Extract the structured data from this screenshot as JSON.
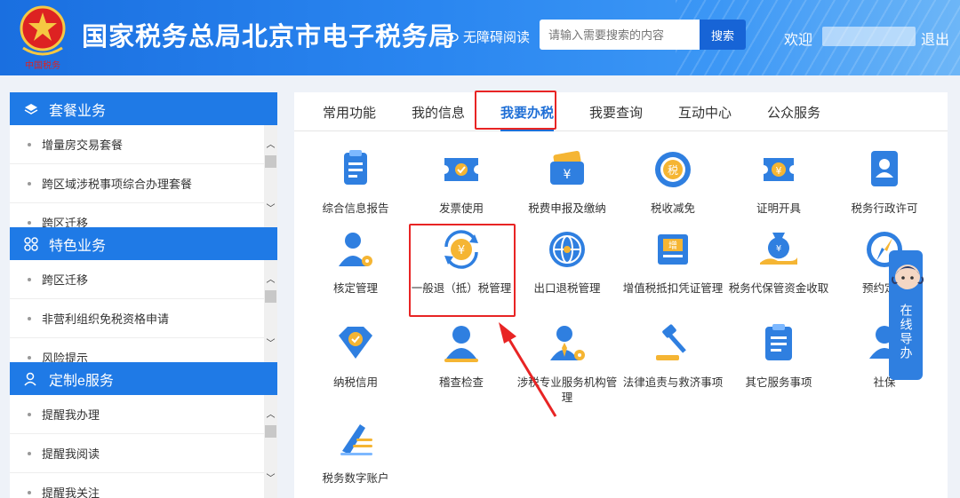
{
  "header": {
    "emblem_caption": "中国税务",
    "title": "国家税务总局北京市电子税务局",
    "accessible_label": "无障碍阅读",
    "search_placeholder": "请输入需要搜索的内容",
    "search_button": "搜索",
    "welcome": "欢迎",
    "logout": "退出"
  },
  "sidebar": [
    {
      "title": "套餐业务",
      "items": [
        "增量房交易套餐",
        "跨区域涉税事项综合办理套餐",
        "跨区迁移"
      ]
    },
    {
      "title": "特色业务",
      "items": [
        "跨区迁移",
        "非营利组织免税资格申请",
        "风险提示"
      ]
    },
    {
      "title": "定制e服务",
      "items": [
        "提醒我办理",
        "提醒我阅读",
        "提醒我关注"
      ]
    }
  ],
  "tabs": [
    "常用功能",
    "我的信息",
    "我要办税",
    "我要查询",
    "互动中心",
    "公众服务"
  ],
  "active_tab": "我要办税",
  "functions": [
    {
      "label": "综合信息报告",
      "icon": "report-icon"
    },
    {
      "label": "发票使用",
      "icon": "invoice-icon"
    },
    {
      "label": "税费申报及缴纳",
      "icon": "tax-payment-icon"
    },
    {
      "label": "税收减免",
      "icon": "tax-reduction-icon"
    },
    {
      "label": "证明开具",
      "icon": "certificate-icon"
    },
    {
      "label": "税务行政许可",
      "icon": "admin-permit-icon"
    },
    {
      "label": "核定管理",
      "icon": "assessment-icon"
    },
    {
      "label": "一般退（抵）税管理",
      "icon": "tax-refund-icon"
    },
    {
      "label": "出口退税管理",
      "icon": "export-refund-icon"
    },
    {
      "label": "增值税抵扣凭证管理",
      "icon": "vat-voucher-icon"
    },
    {
      "label": "税务代保管资金收取",
      "icon": "custody-fund-icon"
    },
    {
      "label": "预约定位",
      "icon": "appointment-icon"
    },
    {
      "label": "纳税信用",
      "icon": "tax-credit-icon"
    },
    {
      "label": "稽查检查",
      "icon": "audit-icon"
    },
    {
      "label": "涉税专业服务机构管理",
      "icon": "agency-icon"
    },
    {
      "label": "法律追责与救济事项",
      "icon": "legal-icon"
    },
    {
      "label": "其它服务事项",
      "icon": "other-services-icon"
    },
    {
      "label": "社保",
      "icon": "social-security-icon"
    },
    {
      "label": "税务数字账户",
      "icon": "digital-account-icon"
    }
  ],
  "online_guide": "在线导办",
  "colors": {
    "primary": "#1f7ae6",
    "highlight": "#e82424",
    "active_tab": "#1f6fd6"
  }
}
